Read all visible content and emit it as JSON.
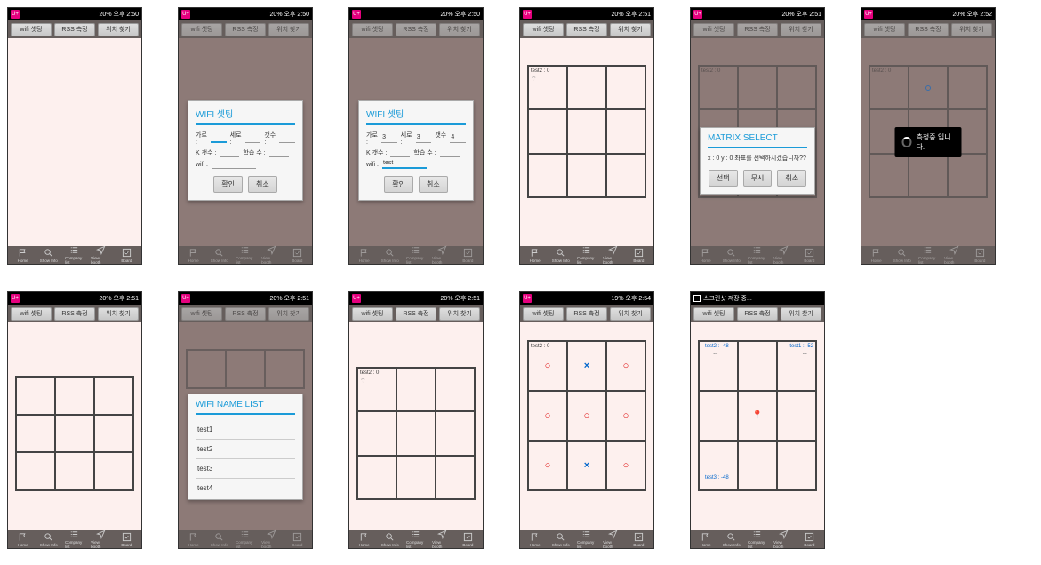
{
  "status": {
    "carrier": "U+",
    "time1": "오후 2:50",
    "time2": "오후 2:51",
    "time3": "오후 2:52",
    "time4": "오후 2:54",
    "batt1": "20%",
    "batt2": "19%",
    "saving": "스크린샷 저장 중..."
  },
  "topbar": {
    "b1": "wifi 셋팅",
    "b2": "RSS 측정",
    "b3": "위치 찾기"
  },
  "botbar": {
    "i1": "Home",
    "i2": "Show Info",
    "i3": "Company list",
    "i4": "View booth",
    "i5": "Board"
  },
  "wifiDialog": {
    "title": "WIFI 셋팅",
    "f1": "가로 :",
    "f2": "세로 :",
    "f3": "갯수 :",
    "f4": "K 갯수 :",
    "f5": "학습 수 :",
    "f6": "wifi :",
    "v1": "3",
    "v2": "3",
    "v3": "4",
    "vwifi": "test",
    "ok": "확인",
    "cancel": "취소"
  },
  "grid": {
    "ap_label": "test2 : 0",
    "ap_label_top": "test2 : 0"
  },
  "matrixDialog": {
    "title": "MATRIX SELECT",
    "msg": "x : 0 y : 0 좌표를 선택하시겠습니까??",
    "b1": "선택",
    "b2": "무시",
    "b3": "취소"
  },
  "toast": {
    "msg": "측정중 입니다."
  },
  "wifiList": {
    "title": "WIFI NAME LIST",
    "items": [
      "test1",
      "test2",
      "test3",
      "test4"
    ]
  },
  "marks": {
    "o": "○",
    "x": "×"
  },
  "loc": {
    "ap_t2": "test2 : -48",
    "ap_t1": "test1 : -52",
    "ap_t3": "test3 : -48"
  }
}
